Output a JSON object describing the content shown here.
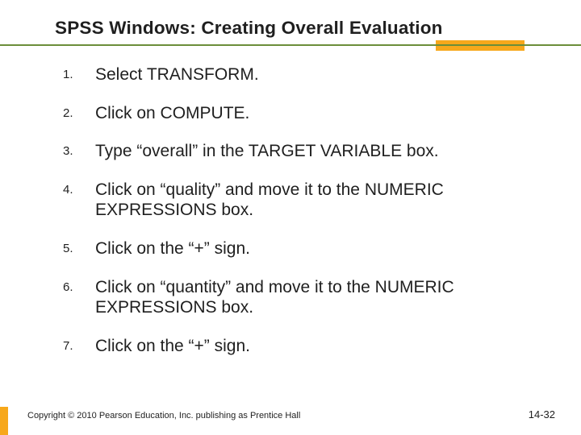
{
  "title": "SPSS Windows: Creating Overall Evaluation",
  "steps": [
    {
      "n": "1.",
      "text": "Select TRANSFORM."
    },
    {
      "n": "2.",
      "text": "Click on COMPUTE."
    },
    {
      "n": "3.",
      "text": "Type “overall” in the TARGET VARIABLE box."
    },
    {
      "n": "4.",
      "text": "Click on “quality” and move it to the NUMERIC EXPRESSIONS box."
    },
    {
      "n": "5.",
      "text": "Click on the “+” sign."
    },
    {
      "n": "6.",
      "text": "Click on “quantity” and move it to the NUMERIC EXPRESSIONS box."
    },
    {
      "n": "7.",
      "text": "Click on the “+” sign."
    }
  ],
  "copyright": "Copyright © 2010 Pearson Education, Inc. publishing as Prentice Hall",
  "page_number": "14-32"
}
